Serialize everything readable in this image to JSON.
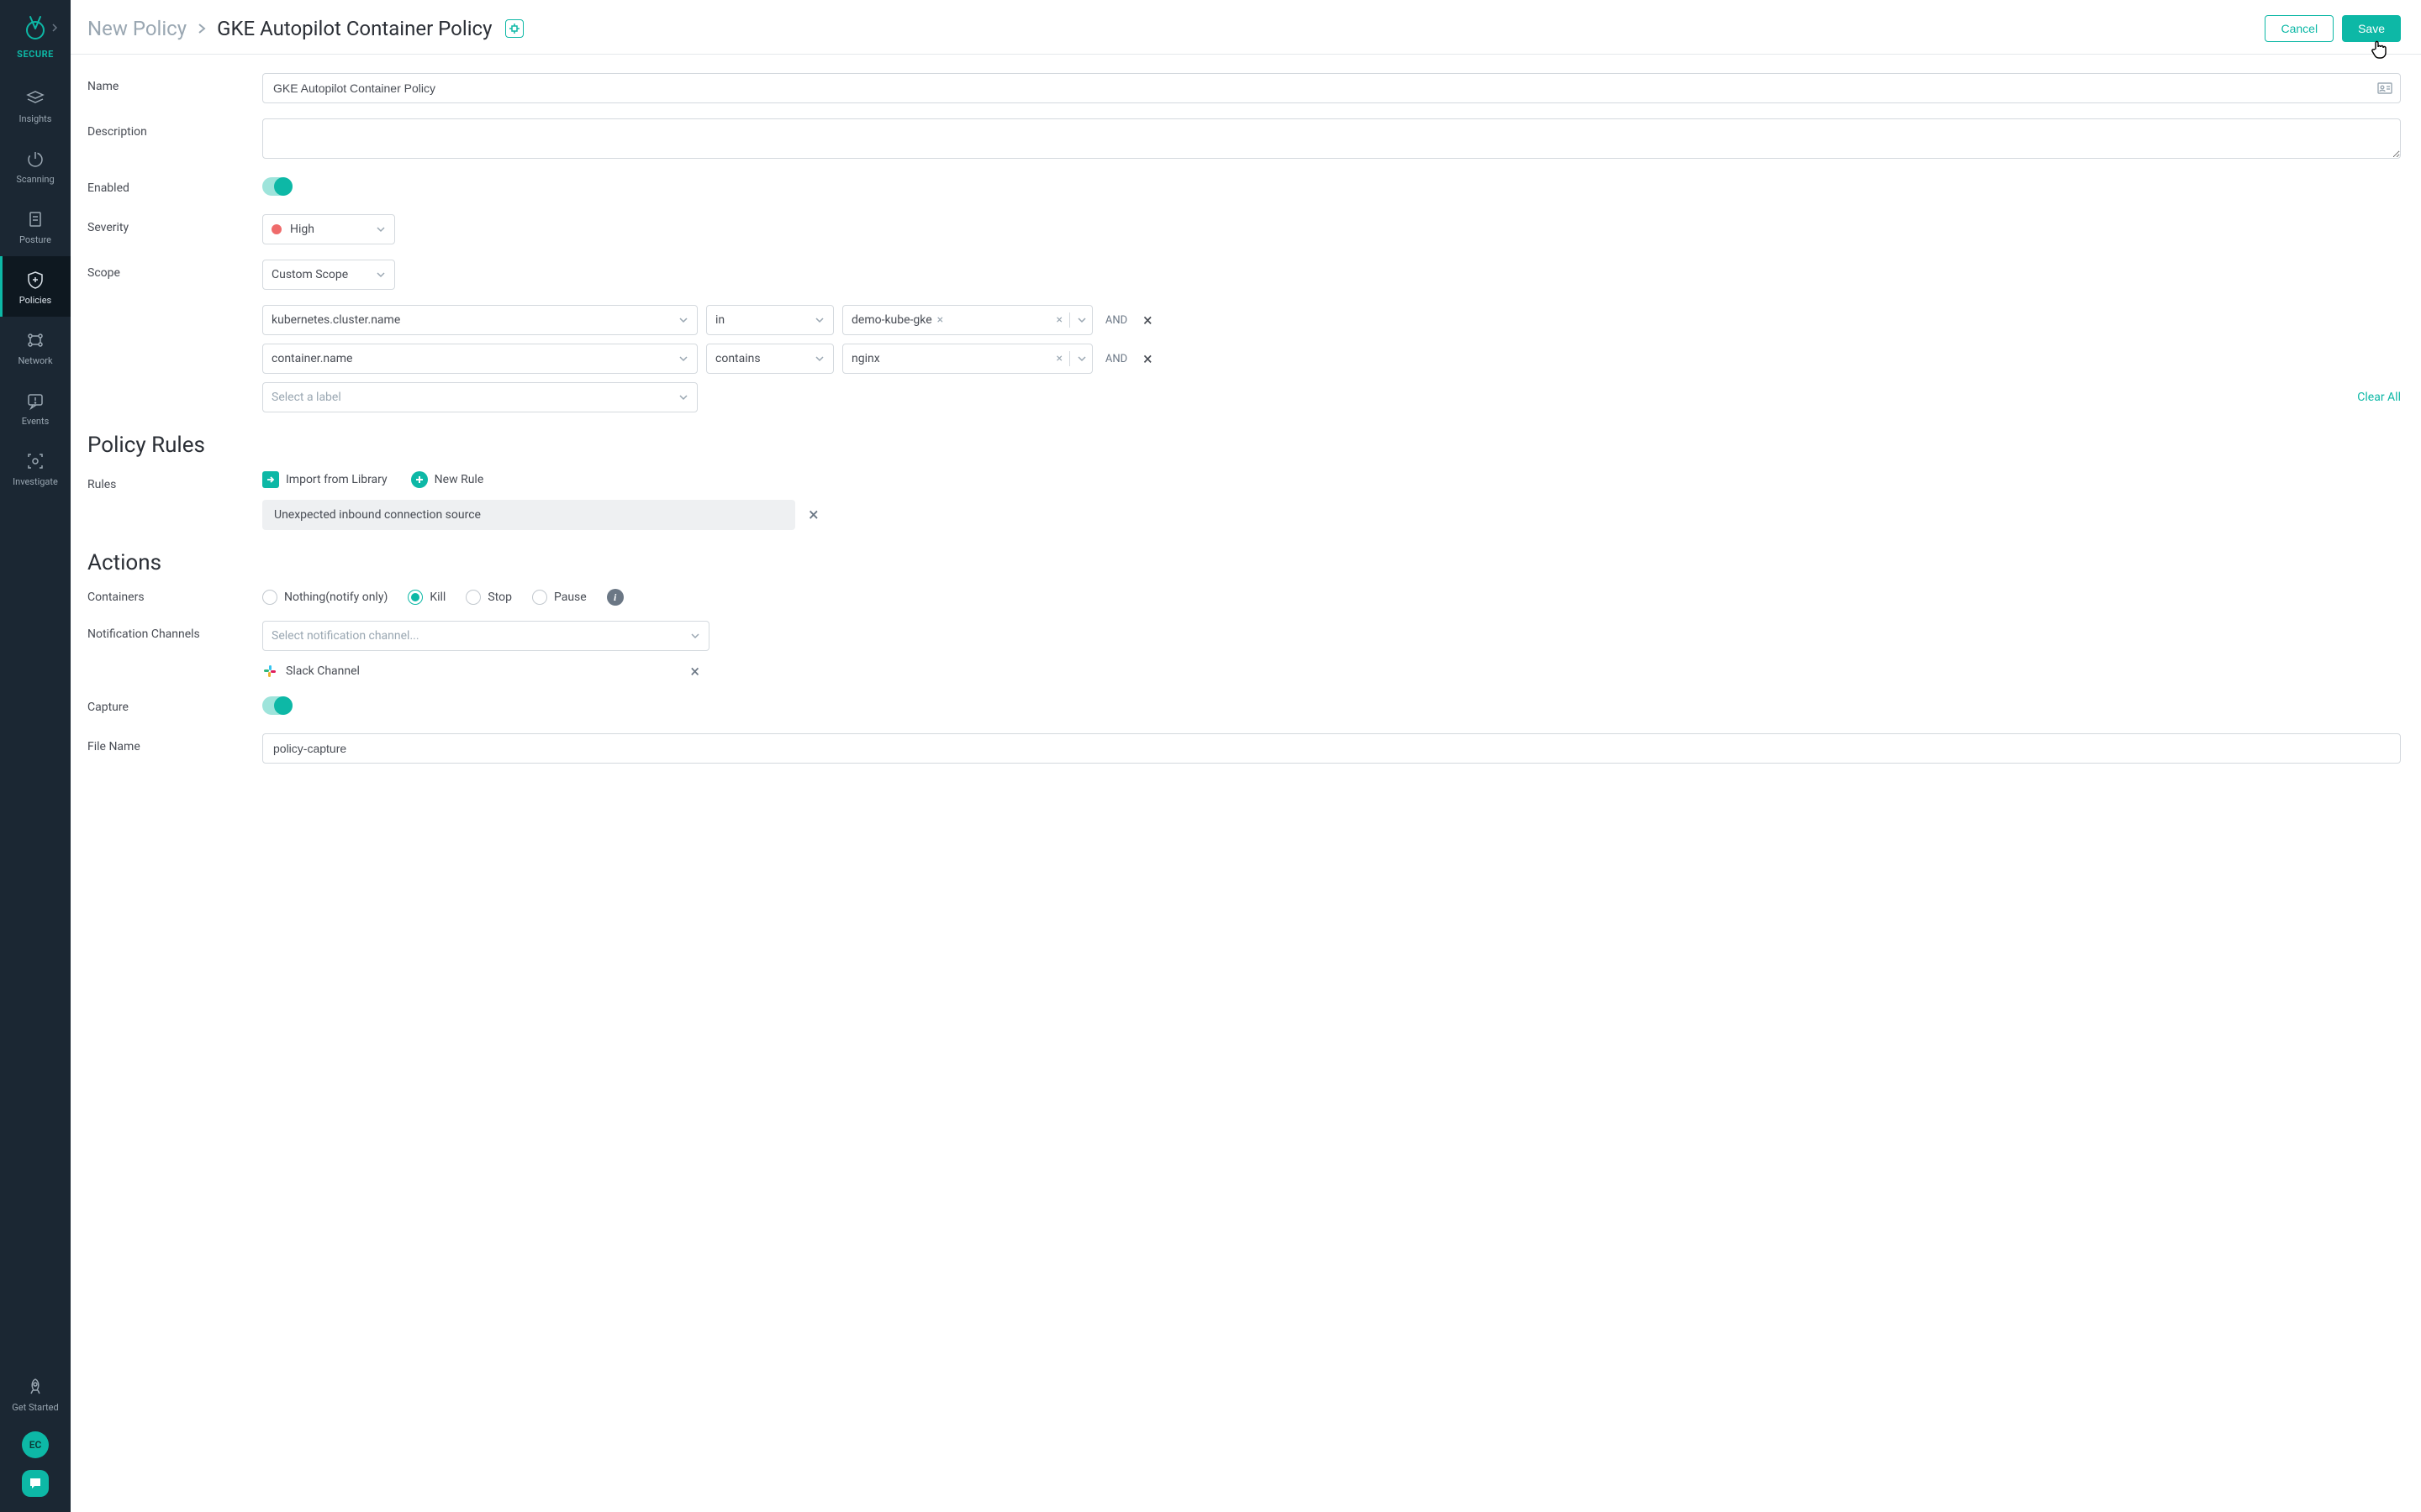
{
  "brand": {
    "label": "SECURE"
  },
  "sidebar": {
    "items": [
      {
        "label": "Insights"
      },
      {
        "label": "Scanning"
      },
      {
        "label": "Posture"
      },
      {
        "label": "Policies"
      },
      {
        "label": "Network"
      },
      {
        "label": "Events"
      },
      {
        "label": "Investigate"
      }
    ],
    "getStarted": "Get Started",
    "avatar": "EC"
  },
  "header": {
    "breadcrumbRoot": "New Policy",
    "breadcrumbLeaf": "GKE Autopilot Container Policy",
    "cancel": "Cancel",
    "save": "Save"
  },
  "form": {
    "nameLabel": "Name",
    "nameValue": "GKE Autopilot Container Policy",
    "descLabel": "Description",
    "descValue": "",
    "enabledLabel": "Enabled",
    "severityLabel": "Severity",
    "severityValue": "High",
    "severityColor": "#ef6b6b",
    "scopeLabel": "Scope",
    "scopeValue": "Custom Scope",
    "clearAll": "Clear All",
    "scopeRows": [
      {
        "key": "kubernetes.cluster.name",
        "op": "in",
        "val": "demo-kube-gke",
        "join": "AND",
        "hasTag": true
      },
      {
        "key": "container.name",
        "op": "contains",
        "val": "nginx",
        "join": "AND",
        "hasTag": false
      }
    ],
    "scopePlaceholder": "Select a label"
  },
  "rulesSection": {
    "title": "Policy Rules",
    "label": "Rules",
    "importLabel": "Import from Library",
    "newRuleLabel": "New Rule",
    "rule0": "Unexpected inbound connection source"
  },
  "actionsSection": {
    "title": "Actions",
    "containersLabel": "Containers",
    "radios": {
      "nothing": "Nothing(notify only)",
      "kill": "Kill",
      "stop": "Stop",
      "pause": "Pause"
    },
    "notifLabel": "Notification Channels",
    "notifPlaceholder": "Select notification channel...",
    "slack": "Slack Channel",
    "captureLabel": "Capture",
    "fileNameLabel": "File Name",
    "fileNameValue": "policy-capture"
  }
}
